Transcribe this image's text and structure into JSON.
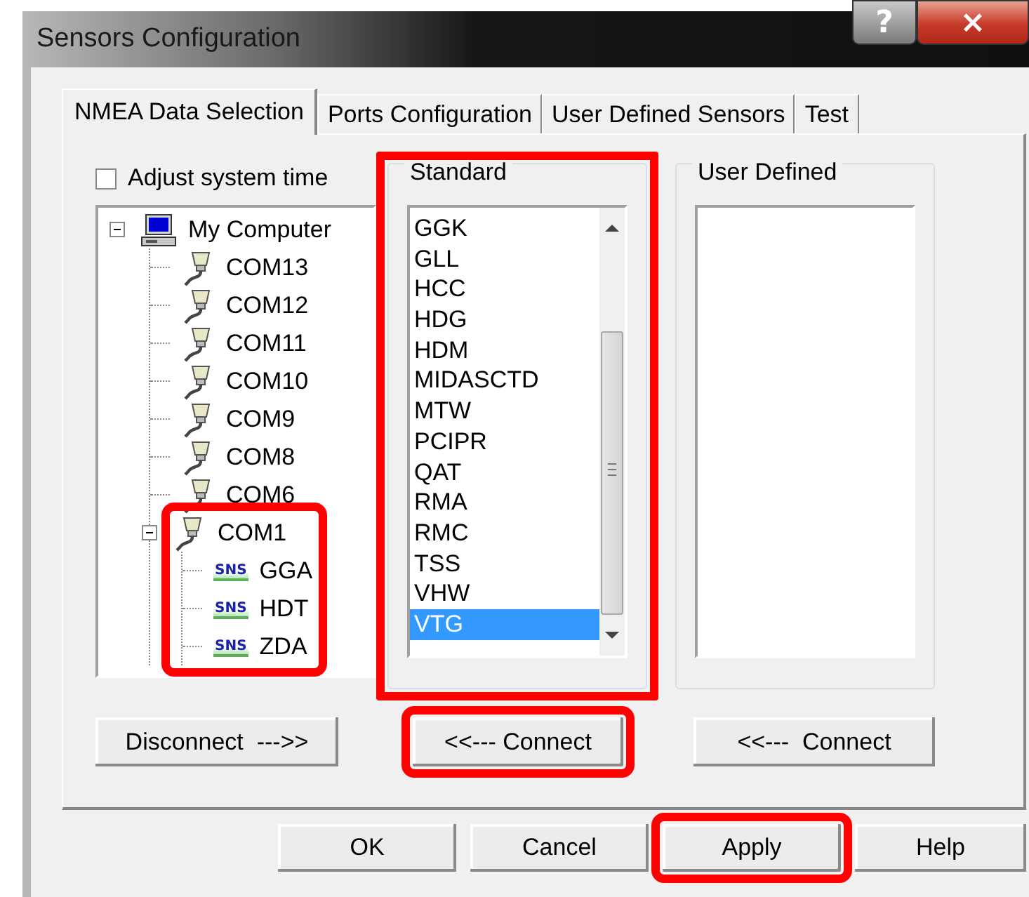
{
  "window": {
    "title": "Sensors Configuration",
    "controls": [
      {
        "kind": "help",
        "label": "?"
      },
      {
        "kind": "close",
        "label": "×"
      }
    ]
  },
  "tabs": [
    {
      "label": "NMEA Data Selection",
      "selected": true
    },
    {
      "label": "Ports Configuration",
      "selected": false
    },
    {
      "label": "User Defined Sensors",
      "selected": false
    },
    {
      "label": "Test",
      "selected": false
    }
  ],
  "adjust_system_time": {
    "label": "Adjust system time",
    "checked": false
  },
  "tree": [
    {
      "label": "My Computer",
      "kind": "computer",
      "expanded": true,
      "children": [
        {
          "label": "COM13",
          "kind": "port"
        },
        {
          "label": "COM12",
          "kind": "port"
        },
        {
          "label": "COM11",
          "kind": "port"
        },
        {
          "label": "COM10",
          "kind": "port"
        },
        {
          "label": "COM9",
          "kind": "port"
        },
        {
          "label": "COM8",
          "kind": "port"
        },
        {
          "label": "COM6",
          "kind": "port"
        },
        {
          "label": "COM1",
          "kind": "port",
          "expanded": true,
          "highlighted": true,
          "children": [
            {
              "label": "GGA",
              "kind": "sensor",
              "badge": "SNS"
            },
            {
              "label": "HDT",
              "kind": "sensor",
              "badge": "SNS"
            },
            {
              "label": "ZDA",
              "kind": "sensor",
              "badge": "SNS"
            }
          ]
        }
      ]
    }
  ],
  "standard": {
    "title": "Standard",
    "highlighted": true,
    "items": [
      {
        "label": "GGK",
        "selected": false
      },
      {
        "label": "GLL",
        "selected": false
      },
      {
        "label": "HCC",
        "selected": false
      },
      {
        "label": "HDG",
        "selected": false
      },
      {
        "label": "HDM",
        "selected": false
      },
      {
        "label": "MIDASCTD",
        "selected": false
      },
      {
        "label": "MTW",
        "selected": false
      },
      {
        "label": "PCIPR",
        "selected": false
      },
      {
        "label": "QAT",
        "selected": false
      },
      {
        "label": "RMA",
        "selected": false
      },
      {
        "label": "RMC",
        "selected": false
      },
      {
        "label": "TSS",
        "selected": false
      },
      {
        "label": "VHW",
        "selected": false
      },
      {
        "label": "VTG",
        "selected": true
      }
    ]
  },
  "user_defined": {
    "title": "User Defined"
  },
  "panel_buttons": [
    {
      "label": "Disconnect  --->>",
      "highlighted": false
    },
    {
      "label": "<<--- Connect",
      "highlighted": true
    },
    {
      "label": "<<---  Connect",
      "highlighted": false
    }
  ],
  "dialog_buttons": [
    {
      "label": "OK",
      "highlighted": false
    },
    {
      "label": "Cancel",
      "highlighted": false
    },
    {
      "label": "Apply",
      "highlighted": true
    },
    {
      "label": "Help",
      "highlighted": false
    }
  ]
}
